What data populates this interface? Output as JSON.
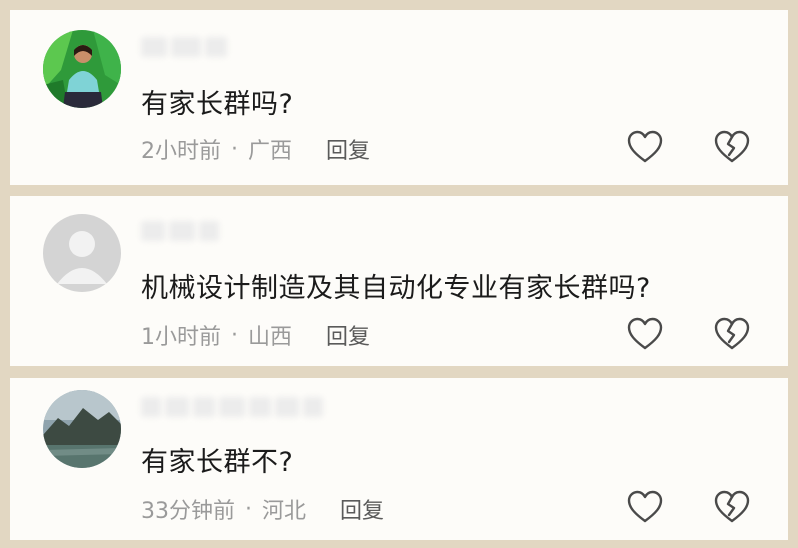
{
  "comments": [
    {
      "text": "有家长群吗?",
      "time": "2小时前",
      "separator": "·",
      "location": "广西",
      "reply_label": "回复",
      "avatar_icon": "avatar-photo-person-in-green-icon"
    },
    {
      "text": "机械设计制造及其自动化专业有家长群吗?",
      "time": "1小时前",
      "separator": "·",
      "location": "山西",
      "reply_label": "回复",
      "avatar_icon": "default-avatar-icon"
    },
    {
      "text": "有家长群不?",
      "time": "33分钟前",
      "separator": "·",
      "location": "河北",
      "reply_label": "回复",
      "avatar_icon": "avatar-photo-landscape-icon"
    }
  ],
  "colors": {
    "page_background": "#e2d7c2",
    "card_background": "#fdfcf9",
    "text": "#1b1b1b",
    "meta_text": "#9a9a9a",
    "icon_stroke": "#4a4a4a"
  }
}
